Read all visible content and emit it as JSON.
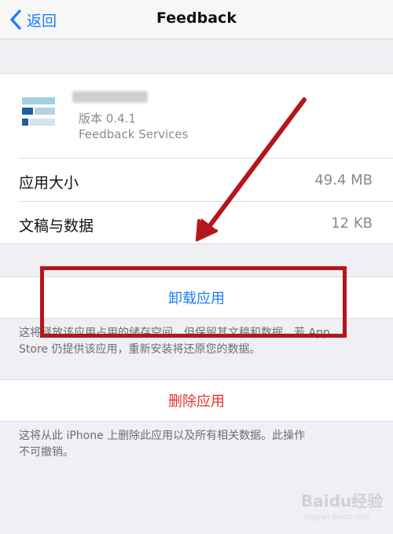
{
  "navbar": {
    "back_label": "返回",
    "title": "Feedback"
  },
  "app": {
    "icon": "app-icon",
    "version": "版本 0.4.1",
    "developer": "Feedback Services"
  },
  "info_rows": [
    {
      "label": "应用大小",
      "value": "49.4 MB"
    },
    {
      "label": "文稿与数据",
      "value": "12 KB"
    }
  ],
  "offload": {
    "label": "卸载应用",
    "description_line1": "这将释放该应用占用的储存空间，但保留其文稿和数据。若 App",
    "description_line2": "Store 仍提供该应用，重新安装将还原您的数据。"
  },
  "delete": {
    "label": "删除应用",
    "description_line1": "这将从此 iPhone 上删除此应用以及所有相关数据。此操作",
    "description_line2": "不可撤销。"
  },
  "colors": {
    "accent": "#1a7cf5",
    "destructive": "#e6322a",
    "annotation": "#b4161a",
    "background": "#efeff4"
  },
  "watermark": {
    "brand": "Baidu经验",
    "url": "jingyan.baidu.com"
  }
}
